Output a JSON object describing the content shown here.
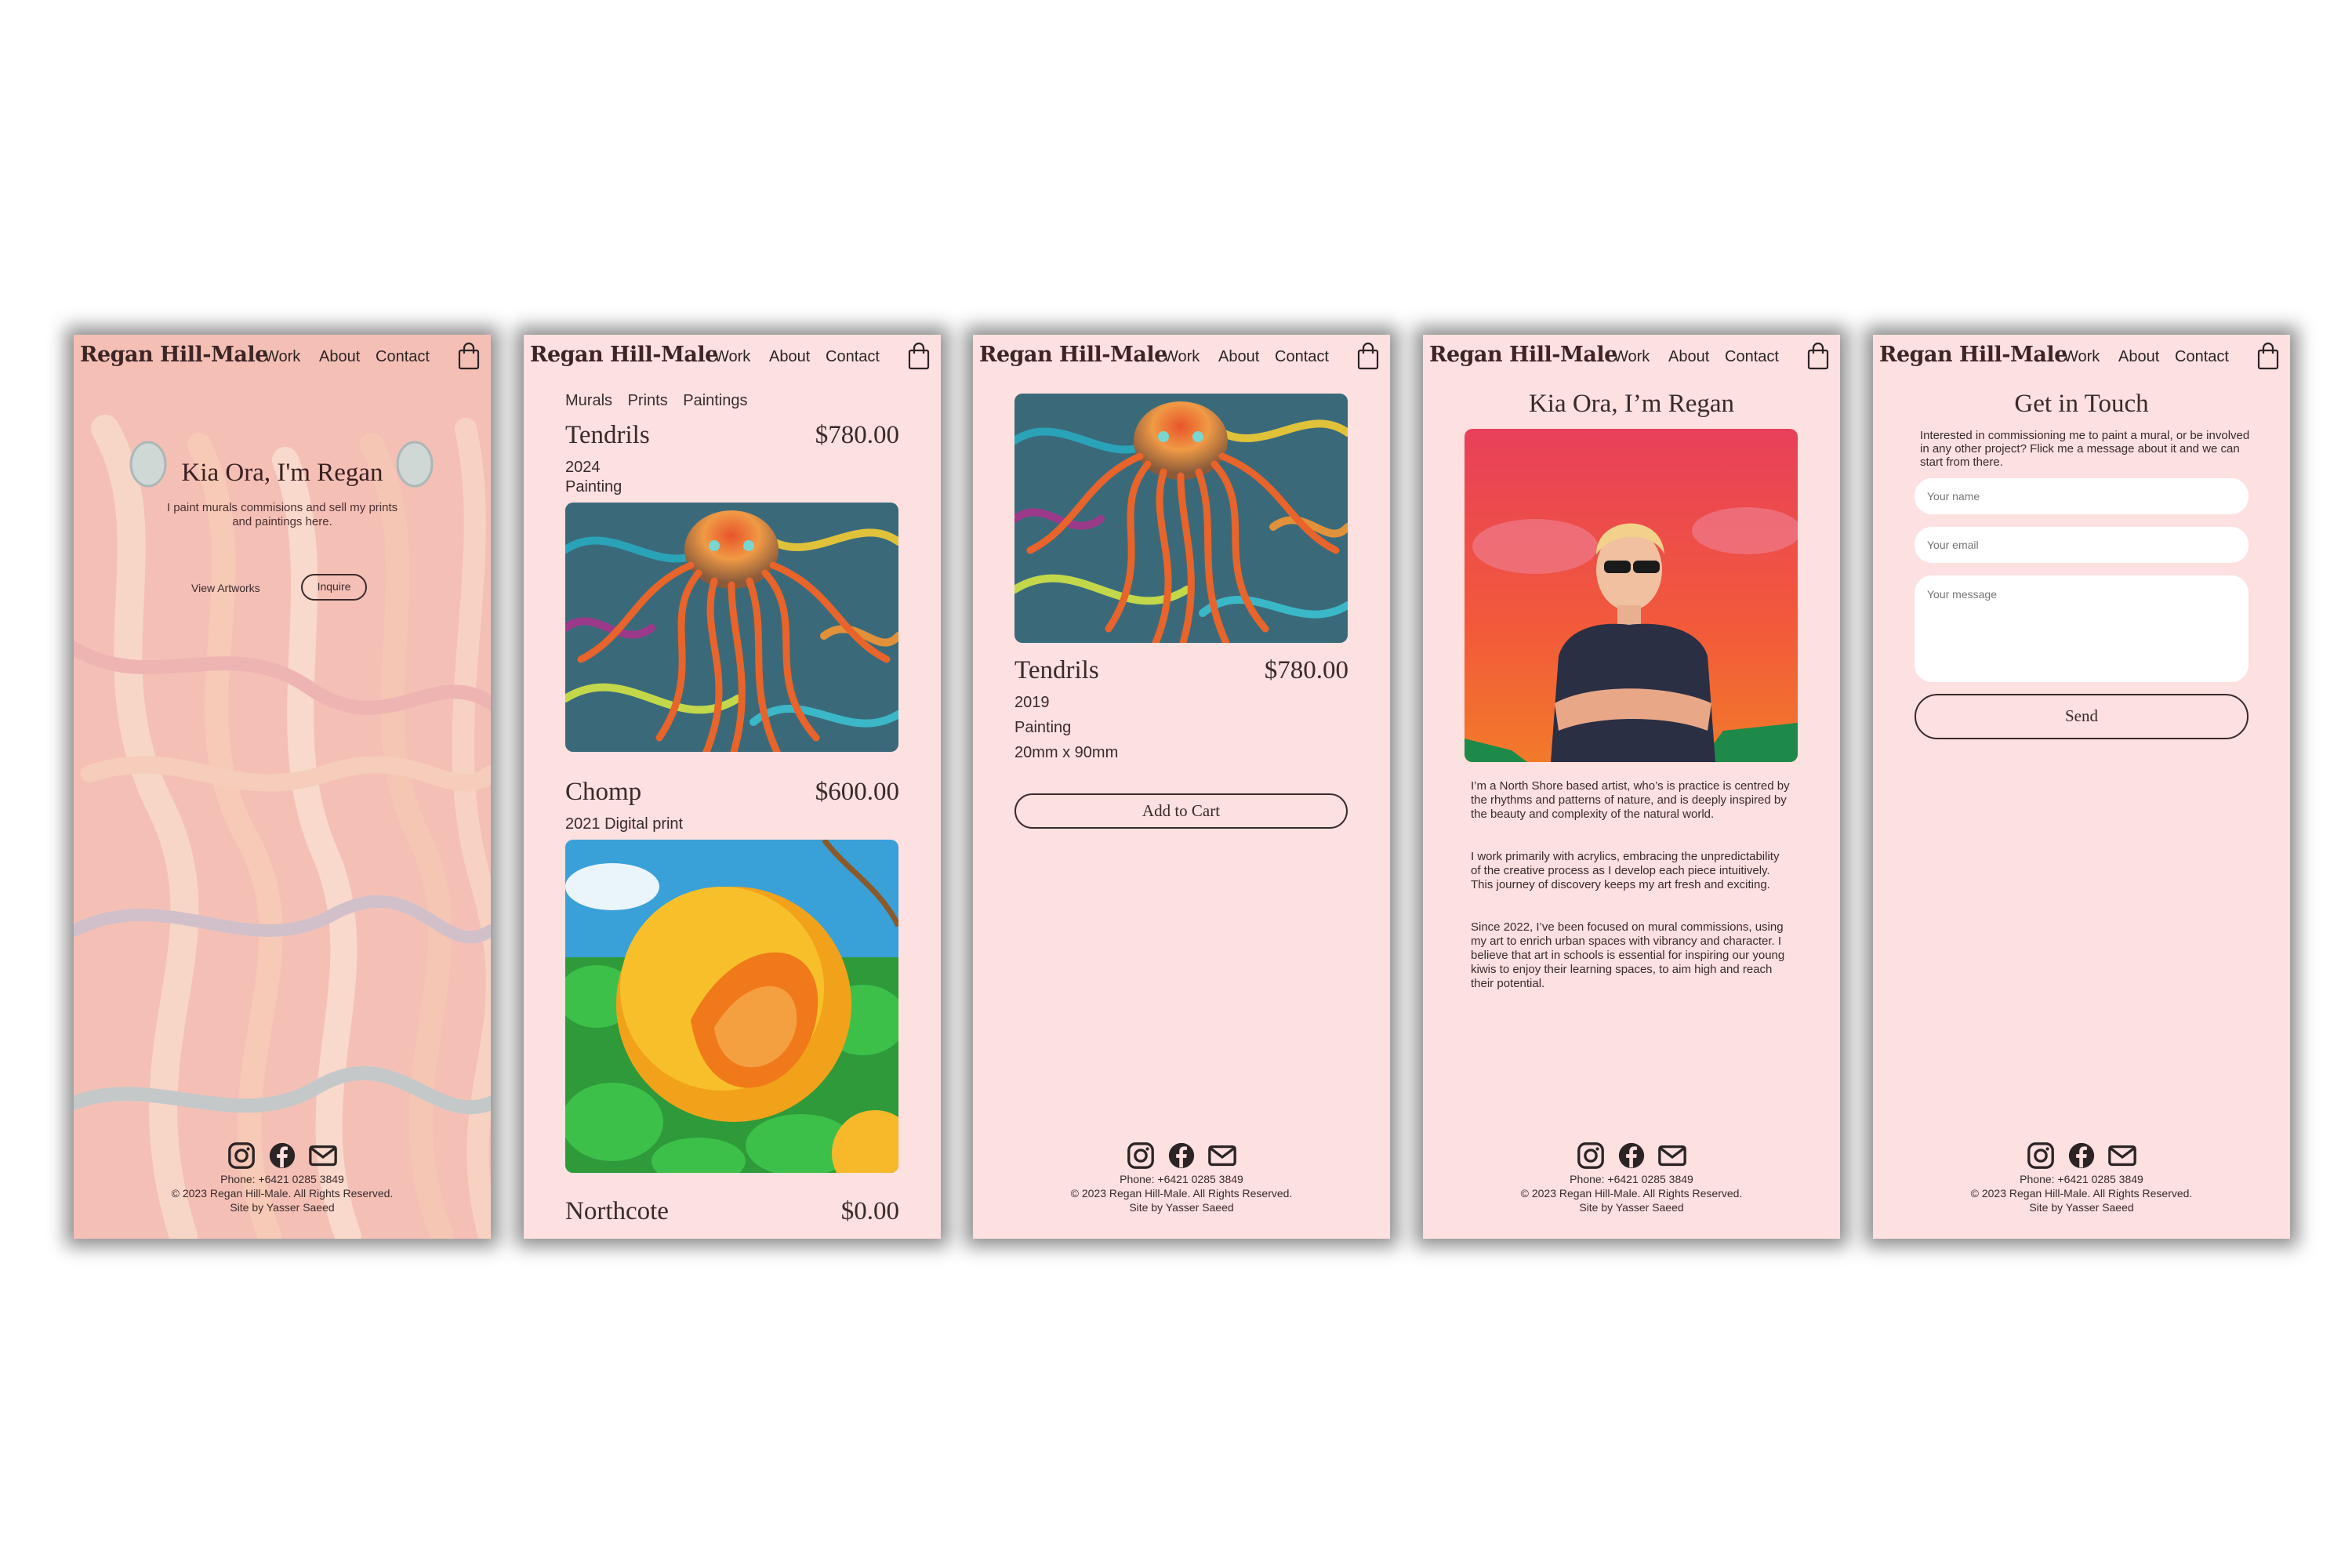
{
  "brand": "Regan Hill-Male",
  "nav": {
    "work": "Work",
    "about": "About",
    "contact": "Contact"
  },
  "footer": {
    "phone": "Phone: +6421 0285 3849",
    "copyright": "© 2023 Regan Hill-Male. All Rights Reserved.",
    "credit": "Site by Yasser Saeed"
  },
  "home": {
    "heading": "Kia Ora, I'm Regan",
    "subtitle": "I paint murals commisions and sell my prints and paintings here.",
    "view_artworks": "View Artworks",
    "inquire": "Inquire"
  },
  "work": {
    "filters": [
      "Murals",
      "Prints",
      "Paintings"
    ],
    "items": [
      {
        "title": "Tendrils",
        "price": "$780.00",
        "year": "2024",
        "medium": "Painting"
      },
      {
        "title": "Chomp",
        "price": "$600.00",
        "year": "2021",
        "medium": "Digital print"
      },
      {
        "title": "Northcote",
        "price": "$0.00"
      }
    ]
  },
  "product": {
    "title": "Tendrils",
    "price": "$780.00",
    "year": "2019",
    "medium": "Painting",
    "size": "20mm x 90mm",
    "add_to_cart": "Add to Cart"
  },
  "about": {
    "heading": "Kia Ora, I’m Regan",
    "paragraphs": [
      "I’m a North Shore based artist, who’s is practice is centred by the rhythms and patterns of nature, and is deeply inspired by the beauty and complexity of the natural world.",
      "I work primarily with acrylics, embracing the unpredictability of the creative process as I develop each piece intuitively. This journey of discovery keeps my art fresh and exciting.",
      "Since 2022, I’ve been focused on mural commissions, using my art to enrich urban spaces with vibrancy and character. I believe that art in schools is essential for inspiring our young kiwis to enjoy their learning spaces, to aim high and reach their potential."
    ]
  },
  "contact": {
    "heading": "Get in Touch",
    "intro": "Interested in commissioning me to paint a mural, or be involved in any other project? Flick me a message about it and we can start from there.",
    "name_placeholder": "Your name",
    "email_placeholder": "Your email",
    "message_placeholder": "Your message",
    "send": "Send"
  },
  "icons": [
    "cart-icon",
    "instagram-icon",
    "facebook-icon",
    "mail-icon"
  ],
  "colors": {
    "page_bg": "#fde0e0",
    "text": "#3a2a2a",
    "brand": "#3d2525"
  }
}
